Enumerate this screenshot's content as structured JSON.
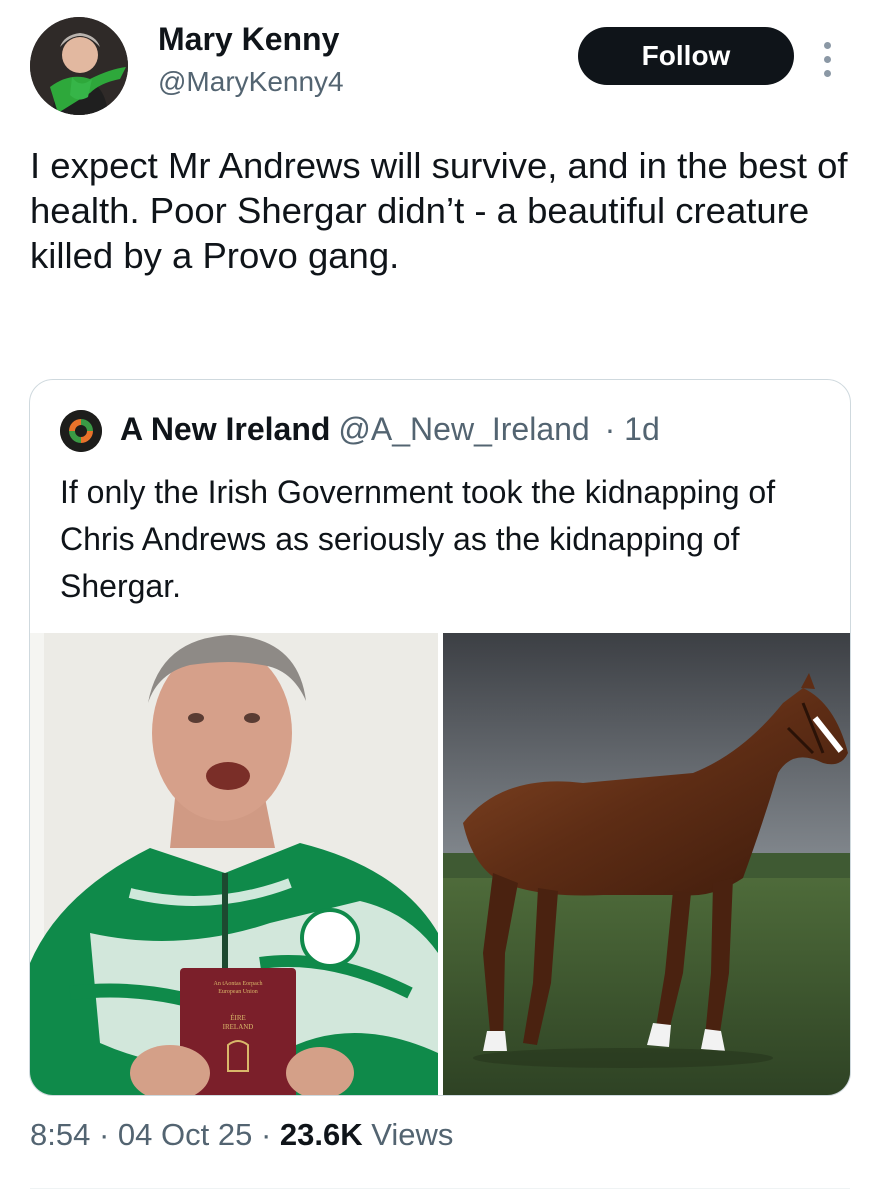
{
  "author": {
    "name": "Mary Kenny",
    "handle": "@MaryKenny4"
  },
  "actions": {
    "follow_label": "Follow",
    "more_icon": "more-vertical-icon"
  },
  "tweet": {
    "text": "I expect Mr Andrews will survive, and in the best of health. Poor Shergar didn’t - a beautiful creature killed by a Provo gang."
  },
  "quoted_tweet": {
    "author_name": "A New Ireland",
    "author_handle": "@A_New_Ireland",
    "time": "· 1d",
    "text": "If only the Irish Government took the kidnapping of Chris Andrews as seriously as the kidnapping of Shergar.",
    "images": [
      {
        "label": "man-holding-passport",
        "passport_lines": [
          "An tAontas Eorpach",
          "European Union",
          "ÉIRE",
          "IRELAND"
        ]
      },
      {
        "label": "brown-horse-in-field"
      }
    ]
  },
  "meta": {
    "time": "8:54",
    "date": "04 Oct 25",
    "views_count": "23.6K",
    "views_label": "Views",
    "sep": "·"
  },
  "colors": {
    "text": "#0f1419",
    "secondary": "#536471",
    "border": "#cfd9de",
    "follow_bg": "#0f1419"
  }
}
